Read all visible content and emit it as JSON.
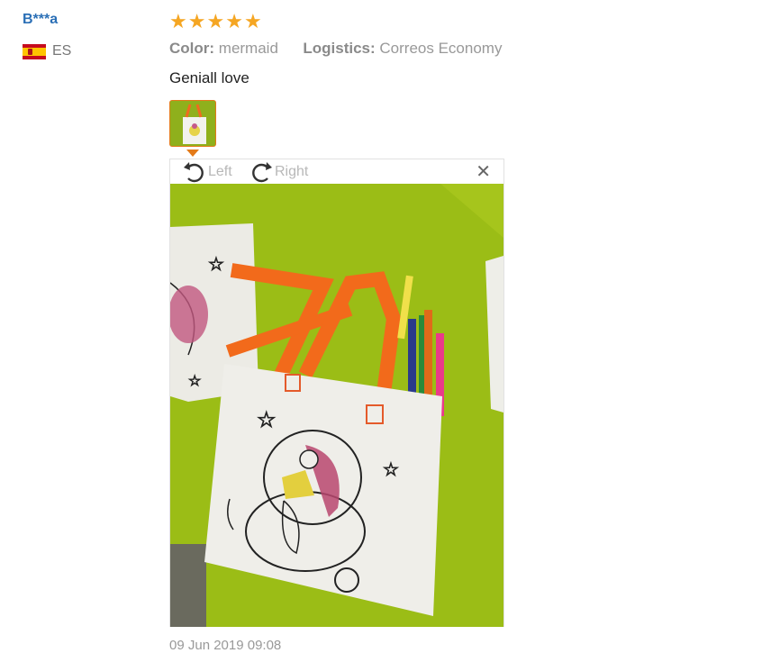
{
  "reviewer": {
    "name": "B***a",
    "country_code": "ES",
    "flag_icon": "spain-flag-icon"
  },
  "review": {
    "rating": 5,
    "stars": [
      "★",
      "★",
      "★",
      "★",
      "★"
    ],
    "color_label": "Color:",
    "color_value": "mermaid",
    "logistics_label": "Logistics:",
    "logistics_value": "Correos Economy",
    "text": "Geniall love",
    "date": "09 Jun 2019 09:08"
  },
  "viewer": {
    "rotate_left_label": "Left",
    "rotate_right_label": "Right",
    "close_glyph": "✕"
  },
  "colors": {
    "accent": "#e37a19",
    "star": "#f5a623",
    "name": "#2a6fb6"
  }
}
